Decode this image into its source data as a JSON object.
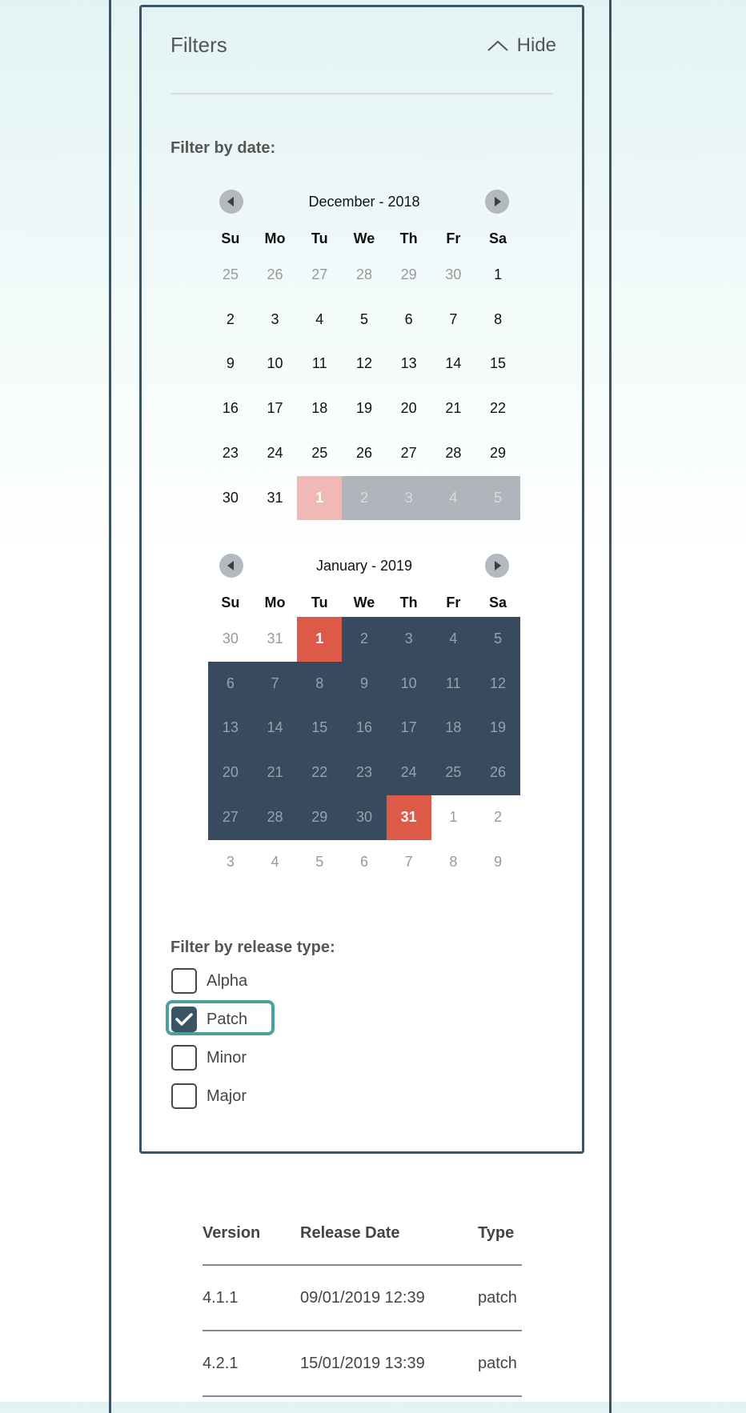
{
  "filters": {
    "title": "Filters",
    "hide_label": "Hide",
    "date_label": "Filter by date:",
    "release_type_label": "Filter by release type:"
  },
  "weekdays": [
    "Su",
    "Mo",
    "Tu",
    "We",
    "Th",
    "Fr",
    "Sa"
  ],
  "calendars": [
    {
      "title": "December - 2018",
      "weeks": [
        [
          {
            "d": "25",
            "s": "muted"
          },
          {
            "d": "26",
            "s": "muted"
          },
          {
            "d": "27",
            "s": "muted"
          },
          {
            "d": "28",
            "s": "muted"
          },
          {
            "d": "29",
            "s": "muted"
          },
          {
            "d": "30",
            "s": "muted"
          },
          {
            "d": "1",
            "s": ""
          }
        ],
        [
          {
            "d": "2",
            "s": ""
          },
          {
            "d": "3",
            "s": ""
          },
          {
            "d": "4",
            "s": ""
          },
          {
            "d": "5",
            "s": ""
          },
          {
            "d": "6",
            "s": ""
          },
          {
            "d": "7",
            "s": ""
          },
          {
            "d": "8",
            "s": ""
          }
        ],
        [
          {
            "d": "9",
            "s": ""
          },
          {
            "d": "10",
            "s": ""
          },
          {
            "d": "11",
            "s": ""
          },
          {
            "d": "12",
            "s": ""
          },
          {
            "d": "13",
            "s": ""
          },
          {
            "d": "14",
            "s": ""
          },
          {
            "d": "15",
            "s": ""
          }
        ],
        [
          {
            "d": "16",
            "s": ""
          },
          {
            "d": "17",
            "s": ""
          },
          {
            "d": "18",
            "s": ""
          },
          {
            "d": "19",
            "s": ""
          },
          {
            "d": "20",
            "s": ""
          },
          {
            "d": "21",
            "s": ""
          },
          {
            "d": "22",
            "s": ""
          }
        ],
        [
          {
            "d": "23",
            "s": ""
          },
          {
            "d": "24",
            "s": ""
          },
          {
            "d": "25",
            "s": ""
          },
          {
            "d": "26",
            "s": ""
          },
          {
            "d": "27",
            "s": ""
          },
          {
            "d": "28",
            "s": ""
          },
          {
            "d": "29",
            "s": ""
          }
        ],
        [
          {
            "d": "30",
            "s": ""
          },
          {
            "d": "31",
            "s": ""
          },
          {
            "d": "1",
            "s": "pink"
          },
          {
            "d": "2",
            "s": "grey"
          },
          {
            "d": "3",
            "s": "grey"
          },
          {
            "d": "4",
            "s": "grey"
          },
          {
            "d": "5",
            "s": "grey"
          }
        ]
      ]
    },
    {
      "title": "January - 2019",
      "weeks": [
        [
          {
            "d": "30",
            "s": "muted"
          },
          {
            "d": "31",
            "s": "muted"
          },
          {
            "d": "1",
            "s": "endpoint"
          },
          {
            "d": "2",
            "s": "sel"
          },
          {
            "d": "3",
            "s": "sel"
          },
          {
            "d": "4",
            "s": "sel"
          },
          {
            "d": "5",
            "s": "sel"
          }
        ],
        [
          {
            "d": "6",
            "s": "sel"
          },
          {
            "d": "7",
            "s": "sel"
          },
          {
            "d": "8",
            "s": "sel"
          },
          {
            "d": "9",
            "s": "sel"
          },
          {
            "d": "10",
            "s": "sel"
          },
          {
            "d": "11",
            "s": "sel"
          },
          {
            "d": "12",
            "s": "sel"
          }
        ],
        [
          {
            "d": "13",
            "s": "sel"
          },
          {
            "d": "14",
            "s": "sel"
          },
          {
            "d": "15",
            "s": "sel"
          },
          {
            "d": "16",
            "s": "sel"
          },
          {
            "d": "17",
            "s": "sel"
          },
          {
            "d": "18",
            "s": "sel"
          },
          {
            "d": "19",
            "s": "sel"
          }
        ],
        [
          {
            "d": "20",
            "s": "sel"
          },
          {
            "d": "21",
            "s": "sel"
          },
          {
            "d": "22",
            "s": "sel"
          },
          {
            "d": "23",
            "s": "sel"
          },
          {
            "d": "24",
            "s": "sel"
          },
          {
            "d": "25",
            "s": "sel"
          },
          {
            "d": "26",
            "s": "sel"
          }
        ],
        [
          {
            "d": "27",
            "s": "sel"
          },
          {
            "d": "28",
            "s": "sel"
          },
          {
            "d": "29",
            "s": "sel"
          },
          {
            "d": "30",
            "s": "sel"
          },
          {
            "d": "31",
            "s": "endpoint"
          },
          {
            "d": "1",
            "s": "muted"
          },
          {
            "d": "2",
            "s": "muted"
          }
        ],
        [
          {
            "d": "3",
            "s": "muted"
          },
          {
            "d": "4",
            "s": "muted"
          },
          {
            "d": "5",
            "s": "muted"
          },
          {
            "d": "6",
            "s": "muted"
          },
          {
            "d": "7",
            "s": "muted"
          },
          {
            "d": "8",
            "s": "muted"
          },
          {
            "d": "9",
            "s": "muted"
          }
        ]
      ]
    }
  ],
  "release_types": [
    {
      "label": "Alpha",
      "checked": false
    },
    {
      "label": "Patch",
      "checked": true
    },
    {
      "label": "Minor",
      "checked": false
    },
    {
      "label": "Major",
      "checked": false
    }
  ],
  "table": {
    "headers": [
      "Version",
      "Release Date",
      "Type"
    ],
    "rows": [
      [
        "4.1.1",
        "09/01/2019 12:39",
        "patch"
      ],
      [
        "4.2.1",
        "15/01/2019 13:39",
        "patch"
      ]
    ]
  },
  "colors": {
    "selected_range": "#374a5e",
    "range_endpoint": "#dd5a48",
    "focus_ring": "#4aa0a0",
    "border": "#3b5463"
  }
}
